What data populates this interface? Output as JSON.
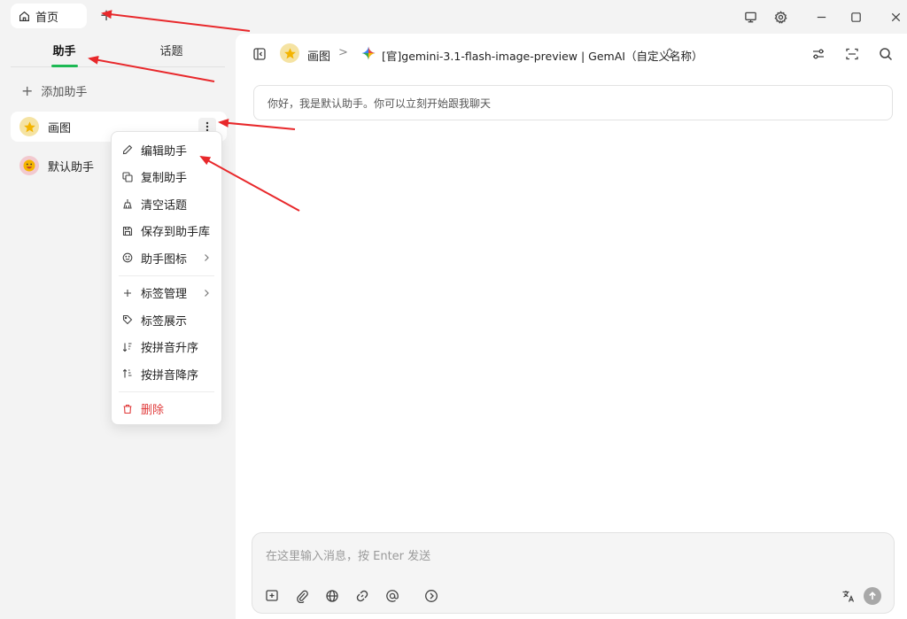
{
  "titlebar": {
    "home_tab": "首页",
    "add_tab_symbol": "+"
  },
  "sidebar": {
    "tabs": [
      {
        "label": "助手",
        "active": true
      },
      {
        "label": "话题",
        "active": false
      }
    ],
    "add_assistant": "添加助手",
    "assistants": [
      {
        "name": "画图",
        "avatar": "star-icon",
        "active": true
      },
      {
        "name": "默认助手",
        "avatar": "smile-face-icon",
        "active": false
      }
    ]
  },
  "context_menu": {
    "items": [
      {
        "label": "编辑助手",
        "icon": "pencil-icon"
      },
      {
        "label": "复制助手",
        "icon": "copy-icon"
      },
      {
        "label": "清空话题",
        "icon": "broom-icon"
      },
      {
        "label": "保存到助手库",
        "icon": "save-icon"
      },
      {
        "label": "助手图标",
        "icon": "smile-icon",
        "submenu": true
      },
      {
        "label": "标签管理",
        "icon": "plus-icon",
        "submenu": true
      },
      {
        "label": "标签展示",
        "icon": "tag-icon"
      },
      {
        "label": "按拼音升序",
        "icon": "sort-asc-icon"
      },
      {
        "label": "按拼音降序",
        "icon": "sort-desc-icon"
      },
      {
        "label": "删除",
        "icon": "trash-icon",
        "danger": true
      }
    ]
  },
  "main": {
    "breadcrumb": {
      "assistant": "画图",
      "separator": ">",
      "model": "[官]gemini-3.1-flash-image-preview | GemAI（自定义名称）"
    },
    "welcome_message": "你好，我是默认助手。你可以立刻开始跟我聊天",
    "input": {
      "placeholder": "在这里输入消息，按 Enter 发送"
    }
  },
  "colors": {
    "accent_green": "#1db954",
    "danger_red": "#e03a3a",
    "annotation_red": "#e8282b",
    "sidebar_bg": "#f3f3f3"
  }
}
